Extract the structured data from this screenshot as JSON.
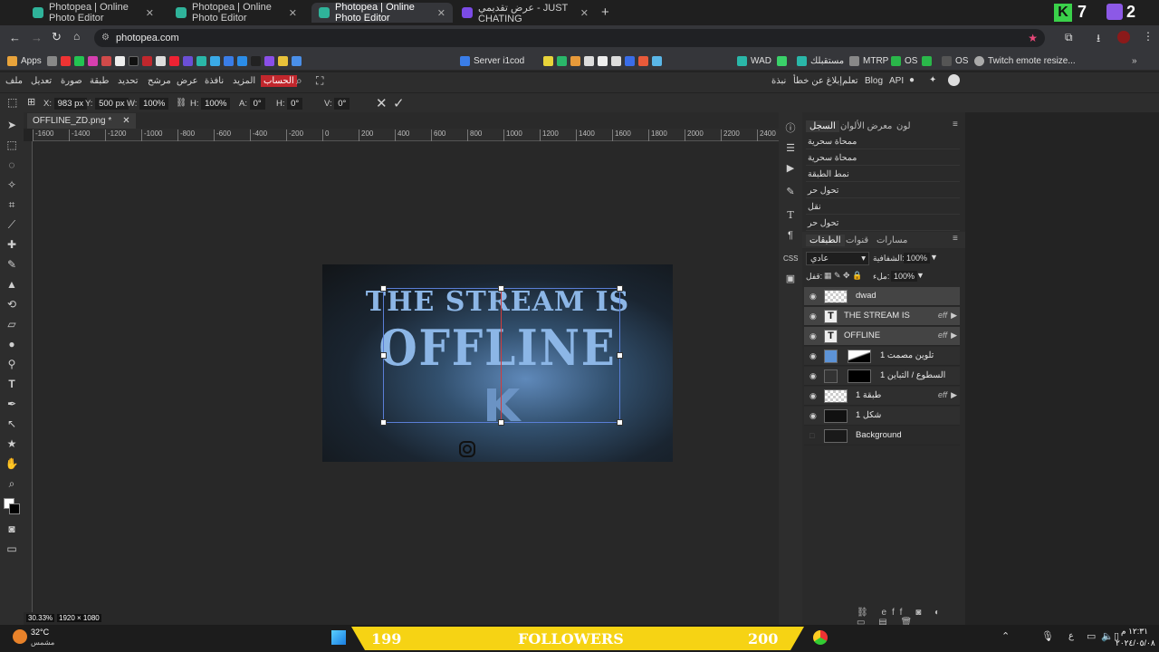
{
  "browser": {
    "tabs": [
      {
        "title": "Photopea | Online Photo Editor",
        "active": false
      },
      {
        "title": "Photopea | Online Photo Editor",
        "active": false
      },
      {
        "title": "Photopea | Online Photo Editor",
        "active": true
      },
      {
        "title": "عرض تقديمي - JUST CHATING",
        "active": false
      }
    ],
    "new_tab": "+",
    "url": "photopea.com",
    "overlay_counts": {
      "left": "7",
      "right": "2"
    },
    "bookmarks": {
      "apps": "Apps",
      "server": "Server i1cod",
      "wad": "WAD",
      "mostaqbalk": "مستقبلك",
      "mtrp": "MTRP",
      "os1": "OS",
      "os2": "OS",
      "twitch": "Twitch emote resize..."
    }
  },
  "menus": {
    "items": [
      "ملف",
      "تعديل",
      "صورة",
      "طبقة",
      "تحديد",
      "مرشح",
      "عرض",
      "نافذة",
      "المزيد"
    ],
    "account": "الحساب",
    "right": [
      "API",
      "Blog",
      "تعلم",
      "إبلاغ عن خطأ",
      "نبذة"
    ]
  },
  "options": {
    "x_label": "X:",
    "x": "983 px",
    "y_label": "Y:",
    "y": "500 px",
    "w_label": "W:",
    "w": "100%",
    "h_label": "H:",
    "h": "100%",
    "a_label": "A:",
    "a": "0°",
    "hs_label": "H:",
    "hs": "0°",
    "v_label": "V:",
    "v": "0°"
  },
  "document": {
    "tab": "OFFLINE_ZD.png *",
    "ruler": [
      "-1600",
      "-1400",
      "-1200",
      "-1000",
      "-800",
      "-600",
      "-400",
      "-200",
      "0",
      "200",
      "400",
      "600",
      "800",
      "1000",
      "1200",
      "1400",
      "1600",
      "1800",
      "2000",
      "2200",
      "2400"
    ],
    "zoom": "30.33%",
    "size": "1920 × 1080",
    "artwork": {
      "line1": "THE STREAM IS",
      "line2": "OFFLINE"
    }
  },
  "history": {
    "tabs": [
      "السجل",
      "معرض الألوان",
      "لون"
    ],
    "items": [
      "ممحاة سحرية",
      "ممحاة سحرية",
      "نمط الطبقة",
      "تحول حر",
      "نقل",
      "تحول حر"
    ]
  },
  "layers": {
    "tabs": [
      "الطبقات",
      "قنوات",
      "مسارات"
    ],
    "blend": "عادي",
    "opacity_label": "الشفافية:",
    "opacity": "100%",
    "lock_label": "قفل:",
    "fill_label": "ملء:",
    "fill": "100%",
    "items": [
      {
        "name": "dwad",
        "fx": ""
      },
      {
        "name": "THE STREAM IS",
        "fx": "eff"
      },
      {
        "name": "OFFLINE",
        "fx": "eff"
      },
      {
        "name": "تلوين مصمت 1",
        "fx": ""
      },
      {
        "name": "السطوع / التباين 1",
        "fx": ""
      },
      {
        "name": "طبقة 1",
        "fx": "eff"
      },
      {
        "name": "شكل 1",
        "fx": ""
      },
      {
        "name": "Background",
        "fx": ""
      }
    ]
  },
  "taskbar": {
    "temp": "32°C",
    "weather": "مشمس",
    "followers_left": "199",
    "followers_label": "FOLLOWERS",
    "followers_right": "200",
    "time": "١٢:٣١ م",
    "date": "٢٠٢٤/٠٥/٠٨",
    "lang": "ع"
  }
}
